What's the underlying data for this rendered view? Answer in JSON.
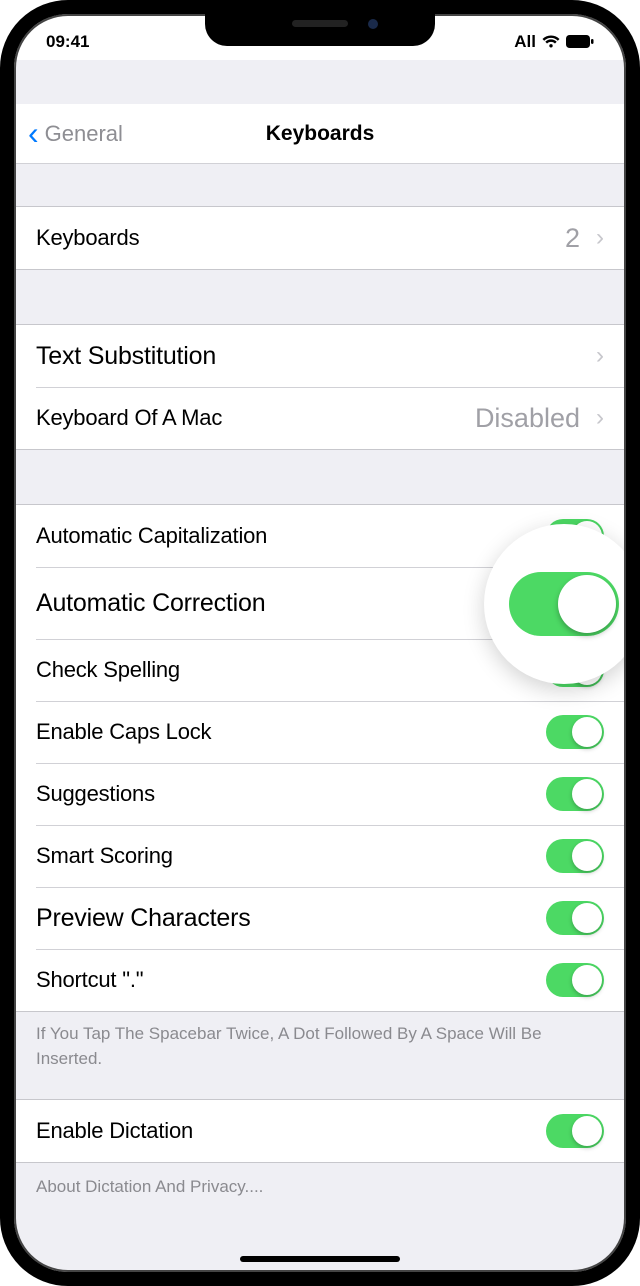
{
  "status": {
    "time": "09:41",
    "carrier": "All"
  },
  "nav": {
    "back_label": "General",
    "title": "Keyboards"
  },
  "section1": {
    "keyboards_label": "Keyboards",
    "keyboards_count": "2"
  },
  "section2": {
    "text_substitution": "Text Substitution",
    "keyboard_mac_label": "Keyboard Of A Mac",
    "keyboard_mac_value": "Disabled"
  },
  "toggles": {
    "auto_capitalization": "Automatic Capitalization",
    "auto_correction": "Automatic Correction",
    "check_spelling": "Check Spelling",
    "caps_lock": "Enable Caps Lock",
    "suggestions": "Suggestions",
    "smart_scoring": "Smart Scoring",
    "preview_chars": "Preview Characters",
    "shortcut": "Shortcut \".\""
  },
  "footer": {
    "shortcut_hint": "If You Tap The Spacebar Twice, A Dot Followed By A Space Will Be Inserted."
  },
  "section4": {
    "enable_dictation": "Enable Dictation",
    "about_link": "About Dictation And Privacy...."
  }
}
